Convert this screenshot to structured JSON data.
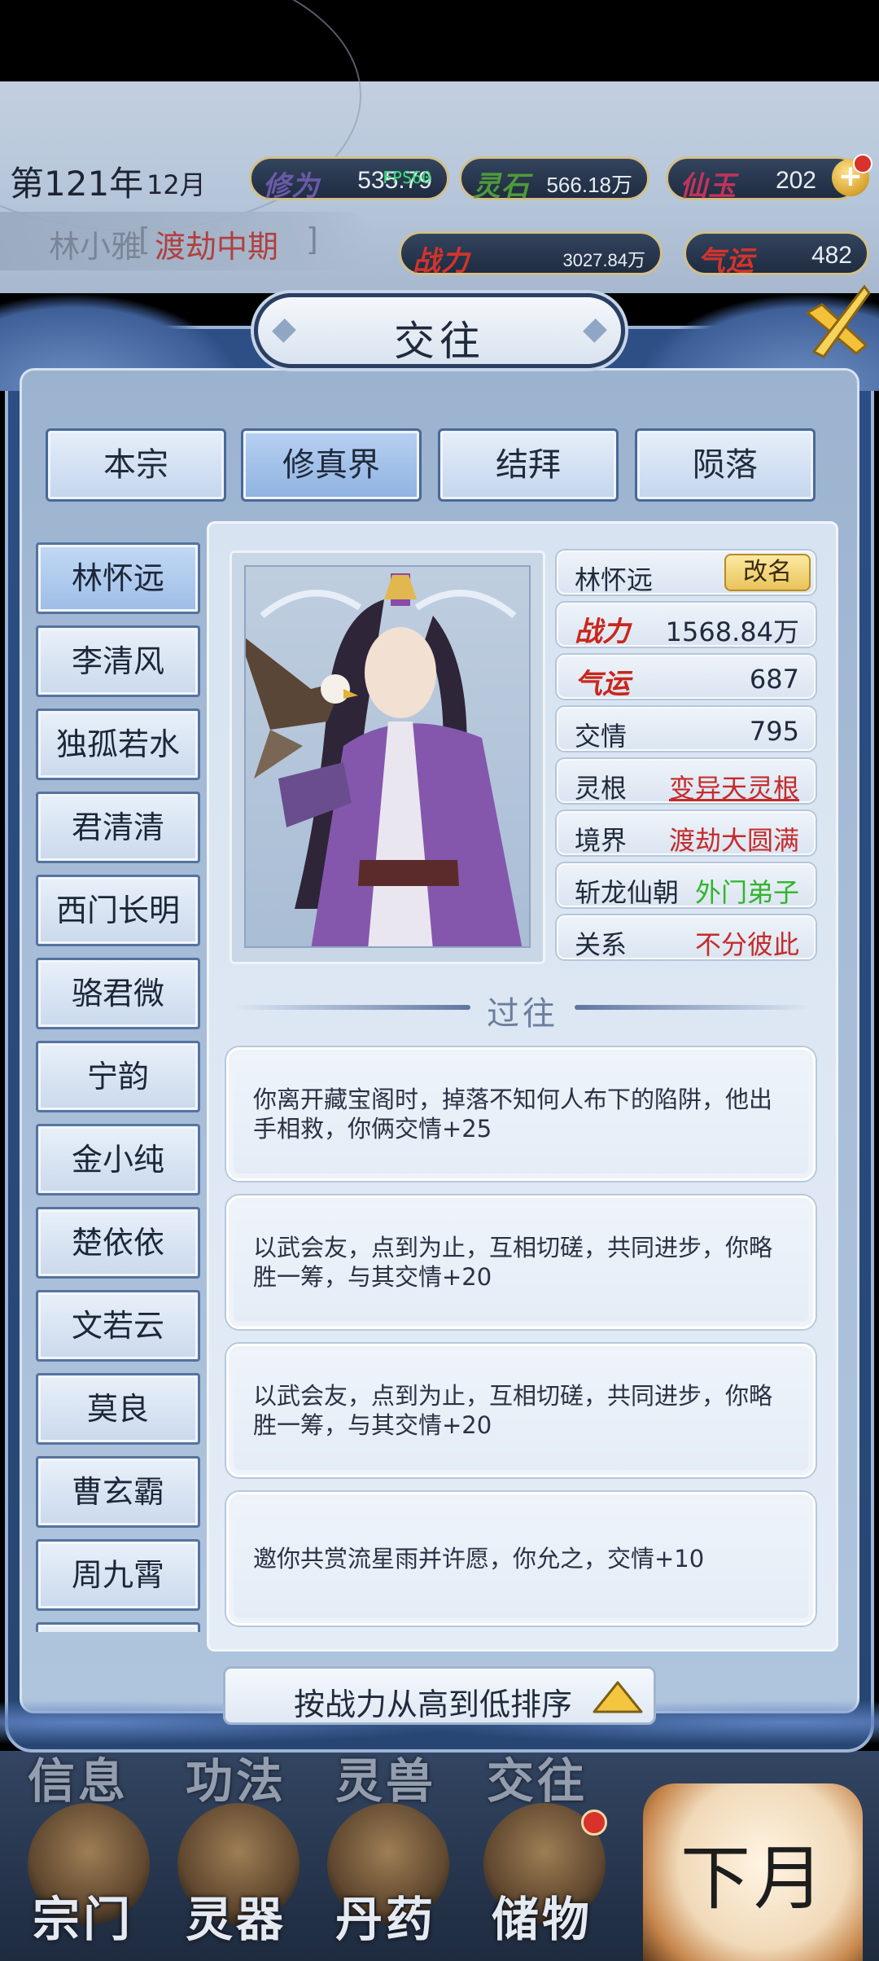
{
  "hud": {
    "year": "第121年",
    "month": "12月",
    "player_name": "林小雅",
    "player_realm": "渡劫中期",
    "bracket_open": "[",
    "bracket_close": "]",
    "fps": "FPS60",
    "resources": {
      "cultivation_label": "修为",
      "cultivation_value": "535.79",
      "spirit_stone_label": "灵石",
      "spirit_stone_value": "566.18万",
      "jade_label": "仙玉",
      "jade_value": "202",
      "power_label": "战力",
      "power_value": "3027.84万",
      "luck_label": "气运",
      "luck_value": "482"
    }
  },
  "panel": {
    "title": "交往",
    "tabs": [
      {
        "label": "本宗",
        "active": false
      },
      {
        "label": "修真界",
        "active": true
      },
      {
        "label": "结拜",
        "active": false
      },
      {
        "label": "陨落",
        "active": false
      }
    ],
    "names": [
      {
        "label": "林怀远",
        "active": true
      },
      {
        "label": "李清风"
      },
      {
        "label": "独孤若水"
      },
      {
        "label": "君清清"
      },
      {
        "label": "西门长明"
      },
      {
        "label": "骆君微"
      },
      {
        "label": "宁韵"
      },
      {
        "label": "金小纯"
      },
      {
        "label": "楚依依"
      },
      {
        "label": "文若云"
      },
      {
        "label": "莫良"
      },
      {
        "label": "曹玄霸"
      },
      {
        "label": "周九霄"
      }
    ],
    "detail": {
      "name": "林怀远",
      "rename_label": "改名",
      "power_label": "战力",
      "power_value": "1568.84万",
      "luck_label": "气运",
      "luck_value": "687",
      "friendship_label": "交情",
      "friendship_value": "795",
      "root_label": "灵根",
      "root_value": "变异天灵根",
      "realm_label": "境界",
      "realm_value": "渡劫大圆满",
      "sect_label": "斩龙仙朝",
      "sect_rank": "外门弟子",
      "relation_label": "关系",
      "relation_value": "不分彼此"
    },
    "past_title": "过往",
    "events": [
      "你离开藏宝阁时，掉落不知何人布下的陷阱，他出手相救，你俩交情+25",
      "以武会友，点到为止，互相切磋，共同进步，你略胜一筹，与其交情+20",
      "以武会友，点到为止，互相切磋，共同进步，你略胜一筹，与其交情+20",
      "邀你共赏流星雨并许愿，你允之，交情+10"
    ],
    "sort_label": "按战力从高到低排序"
  },
  "bottom_nav": {
    "upper": [
      "信息",
      "功法",
      "灵兽",
      "交往"
    ],
    "lower": [
      "宗门",
      "灵器",
      "丹药",
      "储物"
    ],
    "next_month": "下月"
  },
  "colors": {
    "accent_red": "#c52b2b",
    "accent_green": "#2fb52a",
    "gold": "#e9c35a",
    "panel_blue": "#2d4f86"
  }
}
